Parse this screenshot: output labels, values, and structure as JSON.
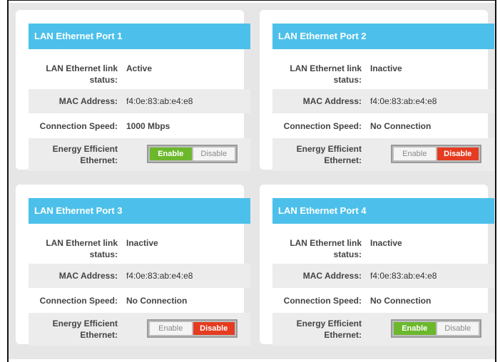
{
  "labels": {
    "link_status": "LAN Ethernet link status:",
    "mac": "MAC Address:",
    "speed": "Connection Speed:",
    "eee": "Energy Efficient Ethernet:"
  },
  "toggle": {
    "enable": "Enable",
    "disable": "Disable"
  },
  "ports": [
    {
      "title": "LAN Ethernet Port 1",
      "link_status": "Active",
      "mac": "f4:0e:83:ab:e4:e8",
      "speed": "1000 Mbps",
      "eee": "Enable"
    },
    {
      "title": "LAN Ethernet Port 2",
      "link_status": "Inactive",
      "mac": "f4:0e:83:ab:e4:e8",
      "speed": "No Connection",
      "eee": "Disable"
    },
    {
      "title": "LAN Ethernet Port 3",
      "link_status": "Inactive",
      "mac": "f4:0e:83:ab:e4:e8",
      "speed": "No Connection",
      "eee": "Disable"
    },
    {
      "title": "LAN Ethernet Port 4",
      "link_status": "Inactive",
      "mac": "f4:0e:83:ab:e4:e8",
      "speed": "No Connection",
      "eee": "Enable"
    }
  ],
  "colors": {
    "header": "#4cc0ea",
    "enable_active": "#6cb82c",
    "disable_active": "#e53b20",
    "row_shade": "#ececec"
  }
}
